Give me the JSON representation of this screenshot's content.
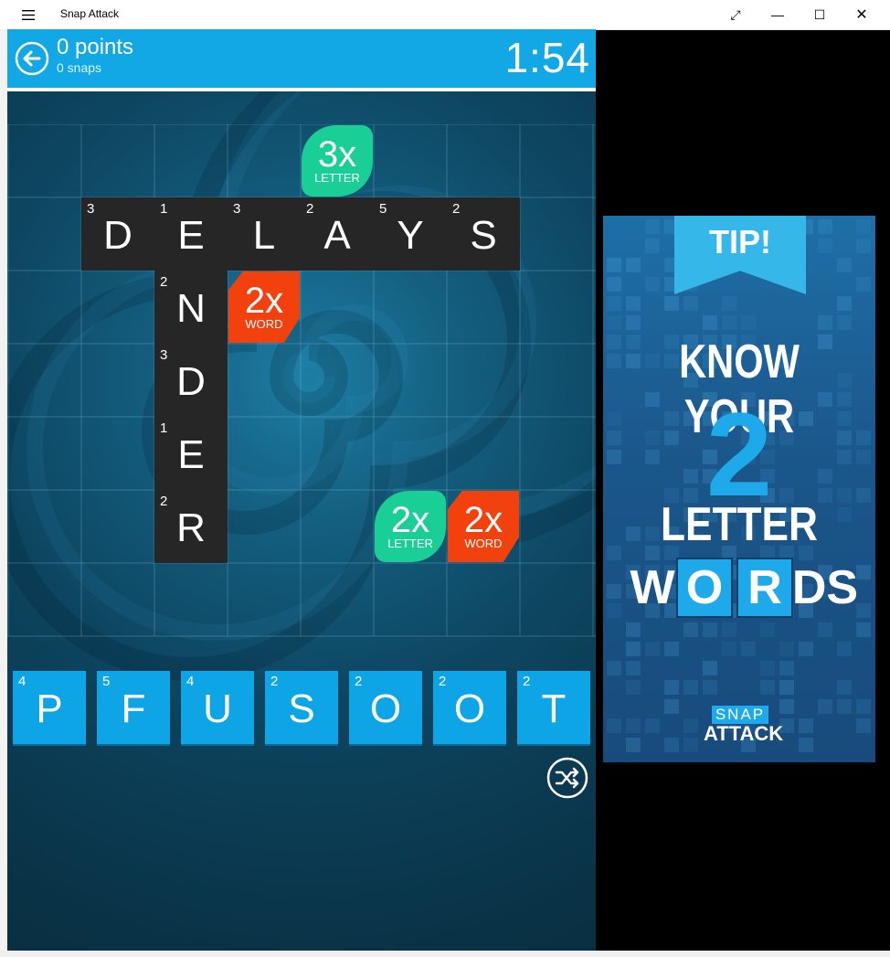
{
  "titlebar": {
    "menu_icon": "hamburger-icon",
    "title": "Snap Attack",
    "fullscreen_icon": "⤢",
    "minimize_icon": "—",
    "maximize_icon": "☐",
    "close_icon": "✕"
  },
  "header": {
    "points": "0 points",
    "snaps": "0 snaps",
    "timer": "1:54",
    "accent": "#12a7e5"
  },
  "board": {
    "columns": 8,
    "rows": 7,
    "placed_tiles": [
      {
        "letter": "D",
        "value": "3",
        "row": 1,
        "col": 1
      },
      {
        "letter": "E",
        "value": "1",
        "row": 1,
        "col": 2
      },
      {
        "letter": "L",
        "value": "3",
        "row": 1,
        "col": 3
      },
      {
        "letter": "A",
        "value": "2",
        "row": 1,
        "col": 4
      },
      {
        "letter": "Y",
        "value": "5",
        "row": 1,
        "col": 5
      },
      {
        "letter": "S",
        "value": "2",
        "row": 1,
        "col": 6
      },
      {
        "letter": "N",
        "value": "2",
        "row": 2,
        "col": 2
      },
      {
        "letter": "D",
        "value": "3",
        "row": 3,
        "col": 2
      },
      {
        "letter": "E",
        "value": "1",
        "row": 4,
        "col": 2
      },
      {
        "letter": "R",
        "value": "2",
        "row": 5,
        "col": 2
      }
    ],
    "bonus_squares": [
      {
        "multiplier": "3x",
        "kind": "LETTER",
        "type": "letter",
        "row": 0,
        "col": 4
      },
      {
        "multiplier": "2x",
        "kind": "WORD",
        "type": "word",
        "row": 2,
        "col": 3
      },
      {
        "multiplier": "2x",
        "kind": "LETTER",
        "type": "letter",
        "row": 5,
        "col": 5
      },
      {
        "multiplier": "2x",
        "kind": "WORD",
        "type": "word",
        "row": 5,
        "col": 6
      }
    ]
  },
  "rack": [
    {
      "letter": "P",
      "value": "4"
    },
    {
      "letter": "F",
      "value": "5"
    },
    {
      "letter": "U",
      "value": "4"
    },
    {
      "letter": "S",
      "value": "2"
    },
    {
      "letter": "O",
      "value": "2"
    },
    {
      "letter": "O",
      "value": "2"
    },
    {
      "letter": "T",
      "value": "2"
    }
  ],
  "ad": {
    "tip": "TIP!",
    "line1": "KNOW YOUR",
    "number": "2",
    "line2": "LETTER",
    "word_letters": [
      "W",
      "O",
      "R",
      "DS"
    ],
    "logo_top": "SNAP",
    "logo_bottom": "ATTACK"
  }
}
